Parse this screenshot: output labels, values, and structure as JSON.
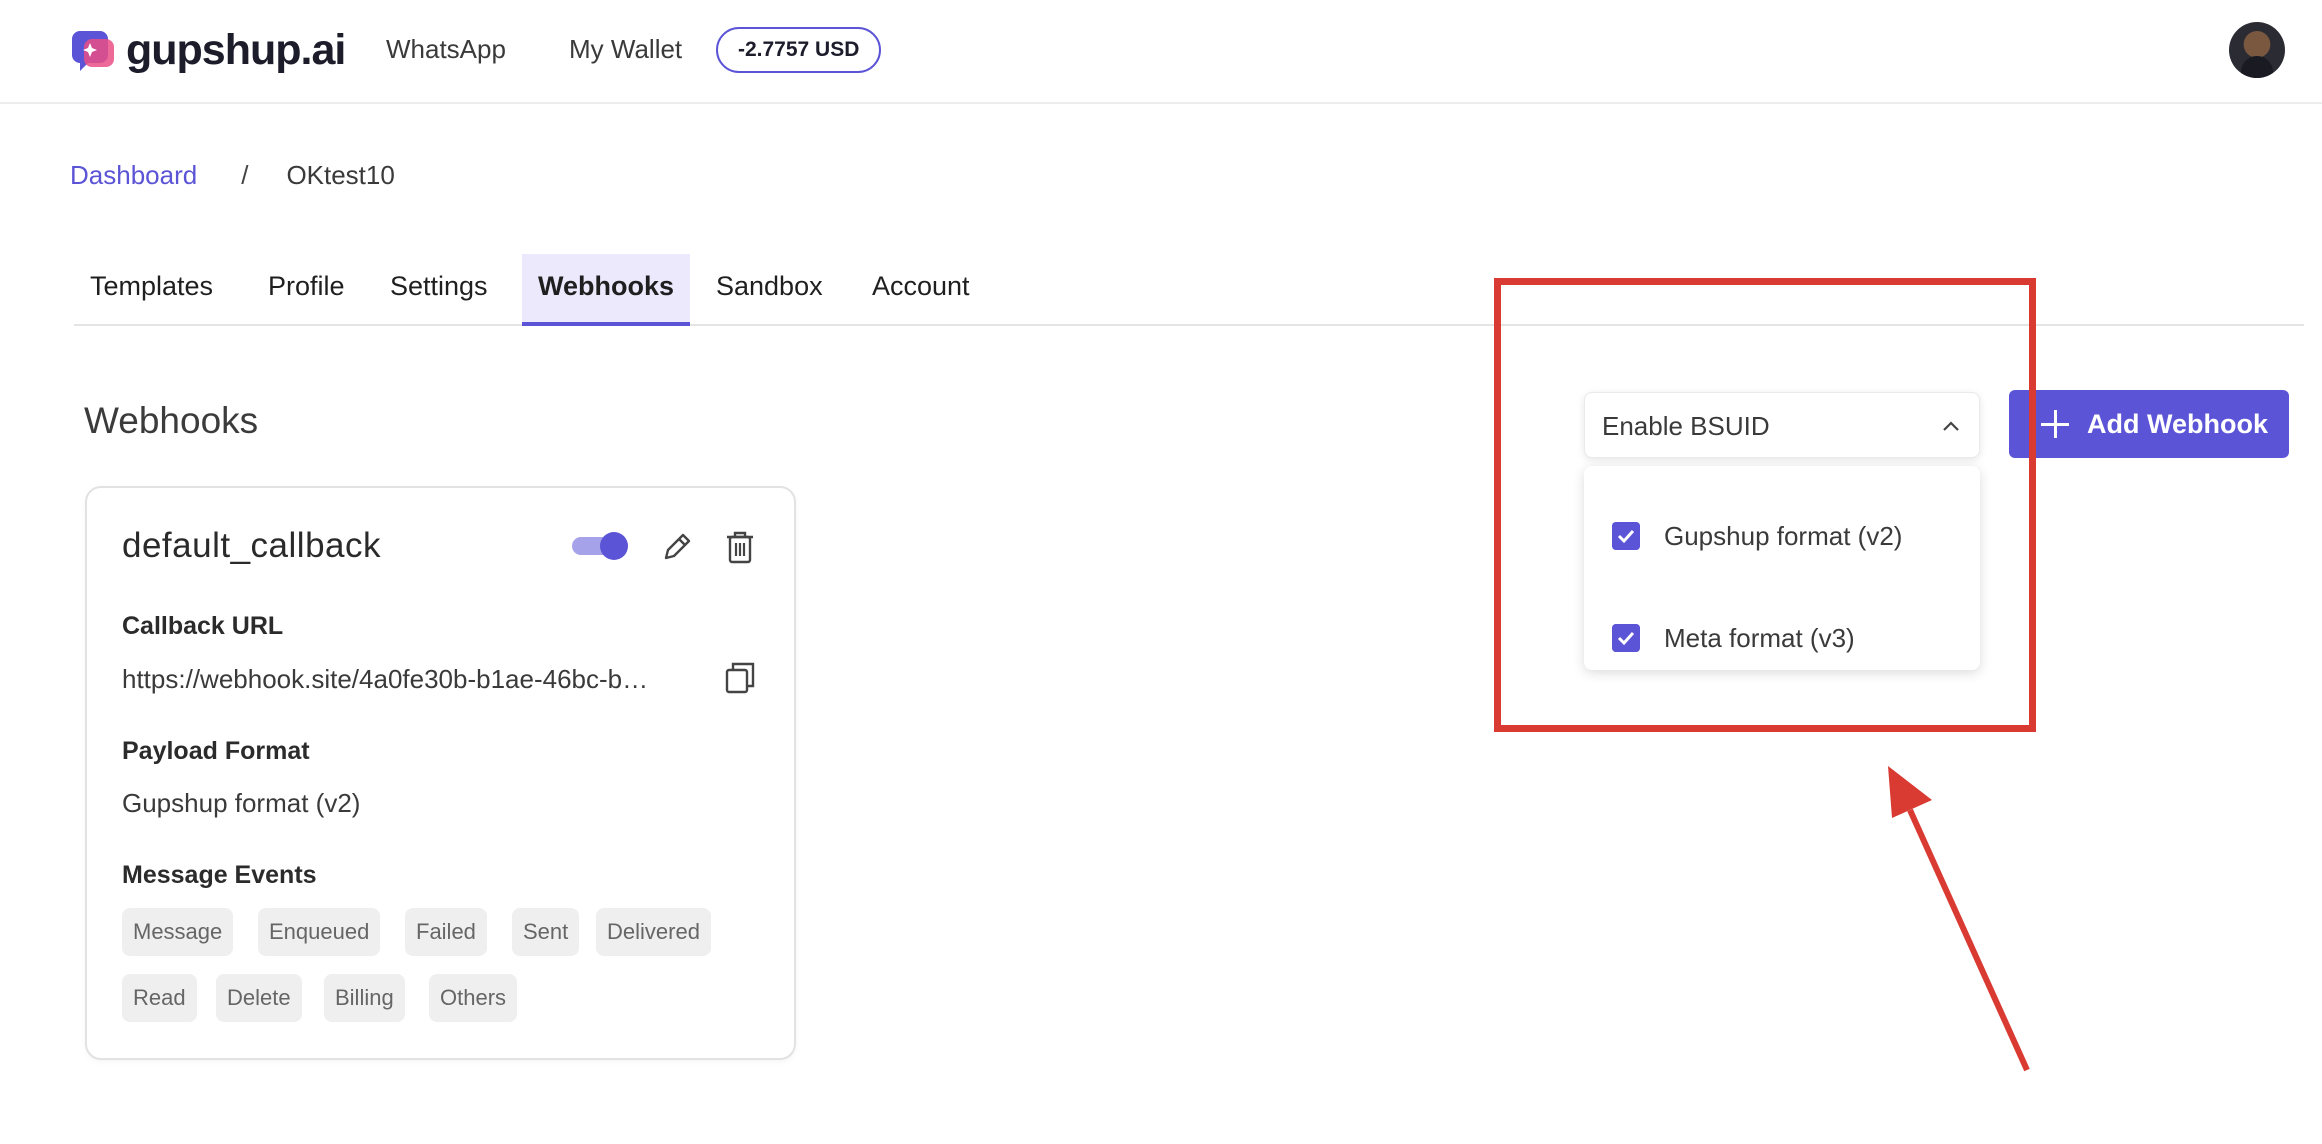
{
  "header": {
    "brand": "gupshup.ai",
    "nav": [
      "WhatsApp",
      "My Wallet"
    ],
    "wallet_balance": "-2.7757 USD"
  },
  "breadcrumb": {
    "root": "Dashboard",
    "separator": "/",
    "current": "OKtest10"
  },
  "tabs": [
    {
      "label": "Templates"
    },
    {
      "label": "Profile"
    },
    {
      "label": "Settings"
    },
    {
      "label": "Webhooks",
      "active": true
    },
    {
      "label": "Sandbox"
    },
    {
      "label": "Account"
    }
  ],
  "section_title": "Webhooks",
  "webhook_card": {
    "name": "default_callback",
    "enabled": true,
    "callback_url_label": "Callback URL",
    "callback_url": "https://webhook.site/4a0fe30b-b1ae-46bc-b…",
    "payload_format_label": "Payload Format",
    "payload_format": "Gupshup format (v2)",
    "message_events_label": "Message Events",
    "events": [
      "Message",
      "Enqueued",
      "Failed",
      "Sent",
      "Delivered",
      "Read",
      "Delete",
      "Billing",
      "Others"
    ]
  },
  "bsuid_select": {
    "label": "Enable BSUID",
    "expanded": true,
    "options": [
      {
        "label": "Gupshup format (v2)",
        "checked": true
      },
      {
        "label": "Meta format (v3)",
        "checked": true
      }
    ]
  },
  "add_webhook_button": {
    "label": "Add Webhook"
  },
  "colors": {
    "accent": "#5b54d6",
    "annotation": "#d93a32"
  }
}
